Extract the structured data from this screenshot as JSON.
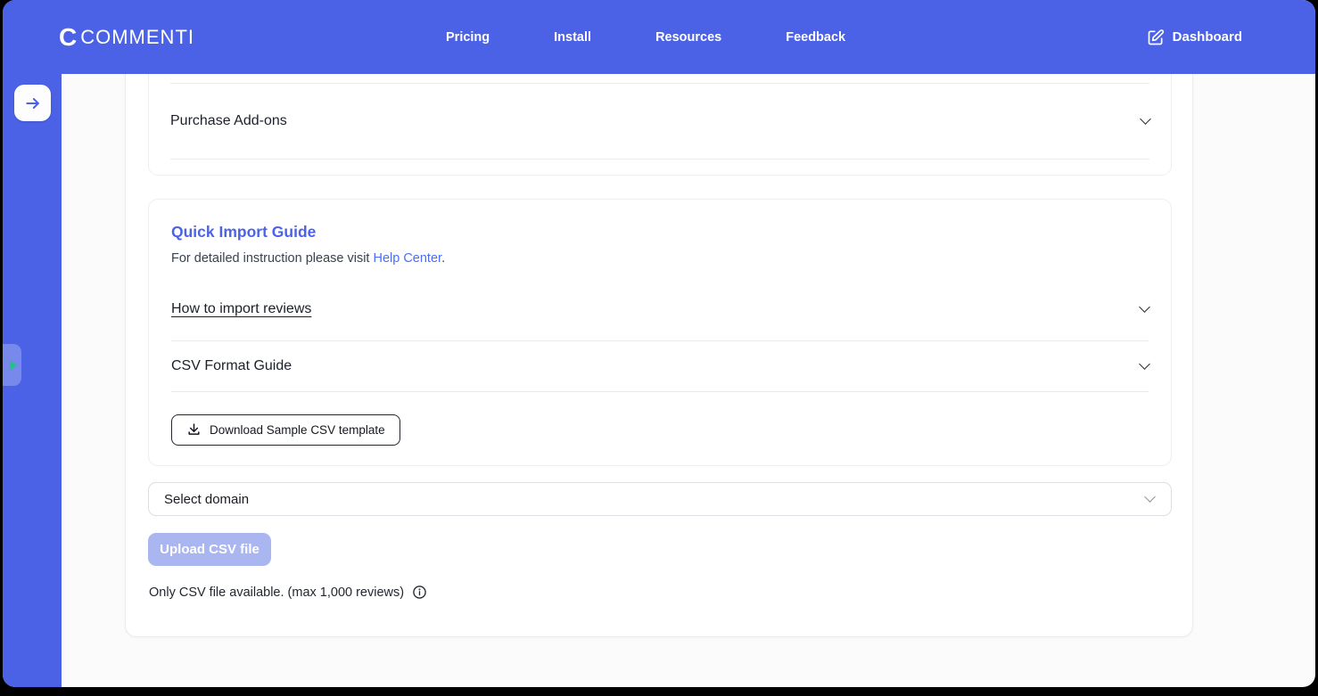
{
  "header": {
    "logo_mark": "C",
    "logo_text": "COMMENTI",
    "nav": [
      {
        "label": "Pricing"
      },
      {
        "label": "Install"
      },
      {
        "label": "Resources"
      },
      {
        "label": "Feedback"
      }
    ],
    "dashboard_label": "Dashboard"
  },
  "sidebar": {
    "collapse_icon": "arrow-right",
    "widget_tab_icon": "play-triangle"
  },
  "addons_card": {
    "title": "Purchase Add-ons"
  },
  "guide_card": {
    "title": "Quick Import Guide",
    "subtitle_prefix": "For detailed instruction please visit ",
    "subtitle_link": "Help Center",
    "subtitle_suffix": ".",
    "accordions": [
      {
        "label": "How to import reviews"
      },
      {
        "label": "CSV Format Guide"
      }
    ],
    "download_button_label": "Download Sample CSV template"
  },
  "import_form": {
    "domain_select_value": "Select domain",
    "upload_button_label": "Upload CSV file",
    "upload_button_state": "disabled",
    "note": "Only CSV file available. (max 1,000 reviews)"
  },
  "colors": {
    "brand_blue": "#4b62e6",
    "link_blue": "#4c6ef5",
    "accent_teal": "#24c08b",
    "disabled_button": "#a9b6f0"
  }
}
